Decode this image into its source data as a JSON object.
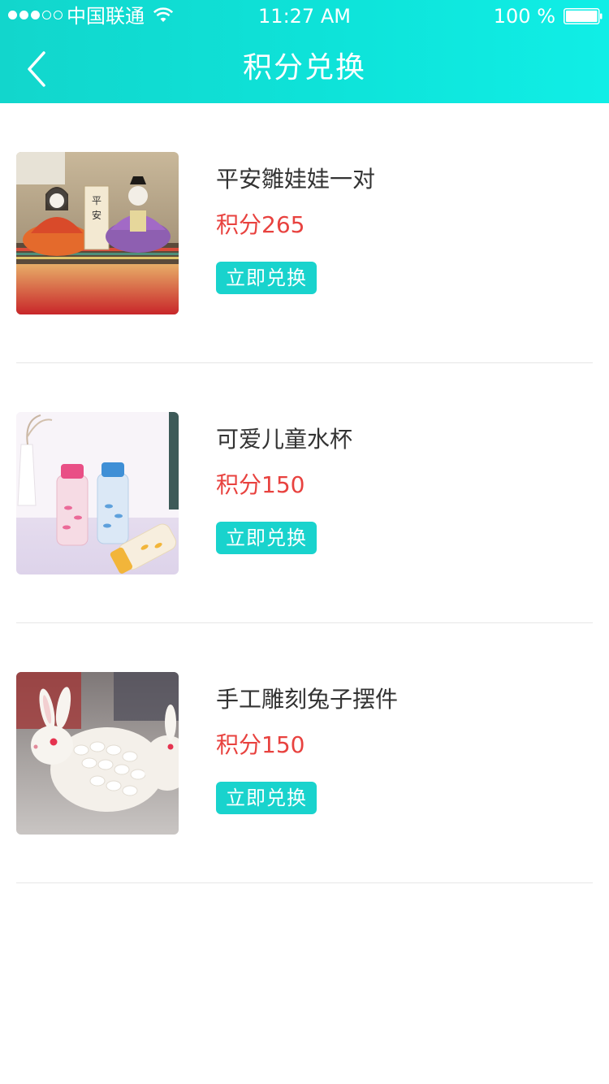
{
  "status_bar": {
    "carrier": "中国联通",
    "time": "11:27 AM",
    "battery": "100 %",
    "signal_filled": 3,
    "signal_total": 5,
    "icons": [
      "signal-icon",
      "wifi-icon",
      "battery-icon"
    ]
  },
  "nav": {
    "title": "积分兑换",
    "back_icon": "chevron-left-icon"
  },
  "items": [
    {
      "name": "平安雛娃娃一对",
      "points": "积分265",
      "button": "立即兑换"
    },
    {
      "name": "可爱儿童水杯",
      "points": "积分150",
      "button": "立即兑换"
    },
    {
      "name": "手工雕刻兔子摆件",
      "points": "积分150",
      "button": "立即兑换"
    }
  ],
  "colors": {
    "accent": "#19d3cd",
    "points": "#e8423f",
    "text": "#333333",
    "divider": "#e6e6e6"
  }
}
